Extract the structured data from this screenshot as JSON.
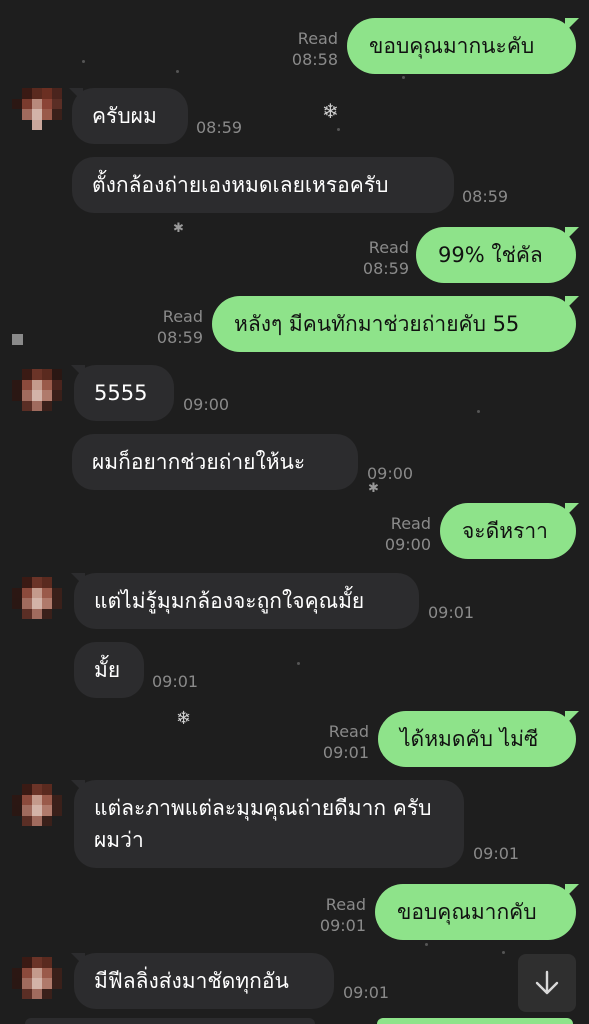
{
  "messages": [
    {
      "text": "ขอบคุณมากนะคับ",
      "status": "Read",
      "time": "08:58"
    },
    {
      "text": "ครับผม",
      "time": "08:59"
    },
    {
      "text": "ตั้งกล้องถ่ายเองหมดเลยเหรอครับ",
      "time": "08:59"
    },
    {
      "text": "99% ใช่คัล",
      "status": "Read",
      "time": "08:59"
    },
    {
      "text": "หลังๆ มีคนทักมาช่วยถ่ายคับ 55",
      "status": "Read",
      "time": "08:59"
    },
    {
      "text": "5555",
      "time": "09:00"
    },
    {
      "text": "ผมก็อยากช่วยถ่ายให้นะ",
      "time": "09:00"
    },
    {
      "text": "จะดีหราา",
      "status": "Read",
      "time": "09:00"
    },
    {
      "text": "แต่ไม่รู้มุมกล้องจะถูกใจคุณมั้ย",
      "time": "09:01"
    },
    {
      "text": "มั้ย",
      "time": "09:01"
    },
    {
      "text": "ได้หมดคับ ไม่ซี",
      "status": "Read",
      "time": "09:01"
    },
    {
      "text": "แต่ละภาพแต่ละมุมคุณถ่ายดีมาก ครับผมว่า",
      "time": "09:01"
    },
    {
      "text": "ขอบคุณมากคับ",
      "status": "Read",
      "time": "09:01"
    },
    {
      "text": "มีฟีลลิ่งส่งมาชัดทุกอัน",
      "time": "09:01"
    }
  ],
  "icons": {
    "avatar": "pixelated-avatar-icon",
    "scroll": "arrow-down-icon",
    "decoration": "snowflake-icon"
  },
  "colors": {
    "background": "#1e1e1e",
    "incoming_bubble": "#2c2c2e",
    "outgoing_bubble": "#8ee38a",
    "meta_text": "#8a8a8a"
  }
}
